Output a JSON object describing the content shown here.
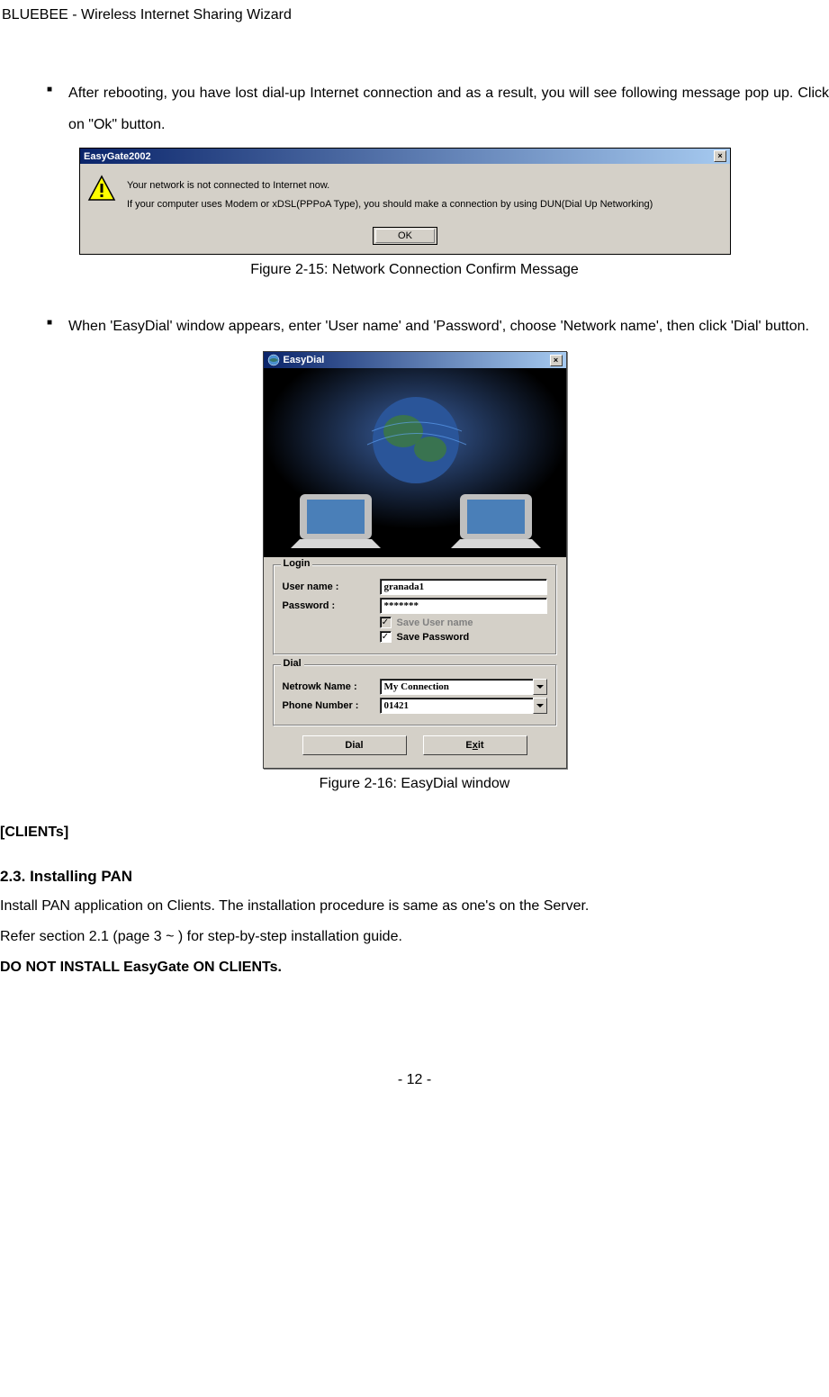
{
  "header": {
    "title": "BLUEBEE - Wireless Internet Sharing Wizard"
  },
  "bullets": [
    {
      "text": "After rebooting, you have lost dial-up Internet connection and as a result, you will see following message pop up. Click on \"Ok\" button."
    },
    {
      "text": "When 'EasyDial' window appears, enter 'User name' and 'Password', choose 'Network name', then click 'Dial' button."
    }
  ],
  "msg_dialog": {
    "title": "EasyGate2002",
    "line1": "Your network is not connected to Internet now.",
    "line2": "If your computer uses Modem or xDSL(PPPoA Type), you should make a connection by using DUN(Dial Up Networking)",
    "ok_label": "OK"
  },
  "captions": {
    "fig1": "Figure 2-15: Network Connection Confirm Message",
    "fig2": "Figure 2-16: EasyDial window"
  },
  "easydial": {
    "title": "EasyDial",
    "login_legend": "Login",
    "username_label": "User name :",
    "username_value": "granada1",
    "password_label": "Password :",
    "password_value": "*******",
    "save_user_label": "Save User name",
    "save_pass_label": "Save Password",
    "dial_legend": "Dial",
    "network_label": "Netrowk Name :",
    "network_value": "My Connection",
    "phone_label": "Phone Number :",
    "phone_value": "01421",
    "dial_btn": "Dial",
    "exit_btn_pre": "E",
    "exit_btn_u": "x",
    "exit_btn_post": "it"
  },
  "clients": {
    "label": "[CLIENTs]"
  },
  "section": {
    "heading": "2.3. Installing PAN",
    "p1": "Install PAN application on Clients. The installation procedure is same as one's on the Server.",
    "p2": "Refer section 2.1 (page 3 ~ ) for step-by-step installation guide.",
    "p3": "DO NOT INSTALL EasyGate ON CLIENTs."
  },
  "footer": {
    "page": "- 12 -"
  }
}
